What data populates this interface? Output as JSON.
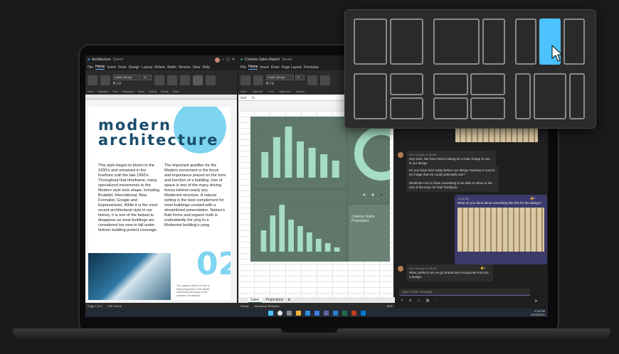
{
  "word": {
    "title": "Architecture",
    "saved": "Saved",
    "menu": [
      "File",
      "Home",
      "Insert",
      "Draw",
      "Design",
      "Layout",
      "Refere",
      "Mailin",
      "Review",
      "View",
      "Help"
    ],
    "font": "Calibri (Body)",
    "font_size": "11",
    "ribbon_groups": [
      "Undo",
      "Clipboard",
      "Font",
      "Paragraph",
      "Styles",
      "Editing",
      "Dictate",
      "Editor"
    ],
    "headline_line1": "modern",
    "headline_line2": "architecture",
    "col1": "This style began to bloom in the 1930's and remained in the forefront until the late 1960's. Throughout that timeframe, many specialized movements to the Modern style took shape, including Brutalist, International, New Formalist, Googie and Expressionist. While it is the most recent architectural style in our history, it is one of the fastest to disappear as most buildings are considered too new to fall under historic building protect coverage.",
    "col2": "The important qualifier for the Modern movement is the focus and importance placed on the form and function of a building. Use of space is one of the many driving forces behind nearly any Modernist structure. A natural setting is the best complement for most buildings created with a streamlined presentation. Nature's fluid forms and organic truth is undoubtedly the ying to a Modernist building's yang.",
    "big_number": "02",
    "caption": "The organic method of form is fairly transparent in the details mentioned previously in this overview of buildings.",
    "status_page": "Page 1 of 3",
    "status_words": "230 Words"
  },
  "excel": {
    "title": "Contoso Sales Report",
    "saved": "Saved",
    "menu": [
      "File",
      "Home",
      "Insert",
      "Draw",
      "Page Layout",
      "Formulas"
    ],
    "font": "Calibri (Body)",
    "font_size": "11",
    "ribbon_groups": [
      "Undo",
      "Clipboard",
      "Font",
      "Alignment",
      "Number"
    ],
    "cell_ref": "D10",
    "panel_title": "Contoso Sales Projections",
    "tabs": [
      "Sales",
      "Projections"
    ],
    "status_ready": "Ready",
    "status_stats": "Workbook Statistics",
    "zoom": "86%"
  },
  "teams": {
    "messages": [
      {
        "meta": "Don Thomas   11:05 AM",
        "text": "Hey Jack. We have been looking for a main image to use in our design"
      },
      {
        "meta": "",
        "text": "Do you have time today before our design meeting to source an image that we could potentially use?"
      },
      {
        "meta": "",
        "text": "Would be nice to have something to be able to show to the rest of the team for their feedback."
      },
      {
        "meta": "Don Thomas   11:45 AM",
        "text": "Wow, perfect! Let me go ahead and incorporate this into a design."
      }
    ],
    "mine": {
      "meta": "11:40 AM",
      "text": "What do you think about something like this for the design?",
      "reactions": "2"
    },
    "first_reaction": "1",
    "compose_placeholder": "Type a new message"
  },
  "taskbar": {
    "time": "2:30 PM",
    "date": "10/05/2021"
  },
  "colors": {
    "accent": "#4cc2ff",
    "word_heading": "#1a4c6b",
    "excel_bar": "#a5dcc4",
    "teams_purple": "#6264a7"
  },
  "chart_data": [
    {
      "type": "bar",
      "series": [
        {
          "values": [
            60,
            95,
            120,
            85,
            70,
            55,
            40
          ]
        }
      ],
      "ylim": [
        0,
        130
      ]
    },
    {
      "type": "bar",
      "series": [
        {
          "values": [
            50,
            85,
            110,
            75,
            60,
            45,
            30,
            20,
            10
          ]
        }
      ],
      "ylim": [
        0,
        130
      ]
    }
  ]
}
